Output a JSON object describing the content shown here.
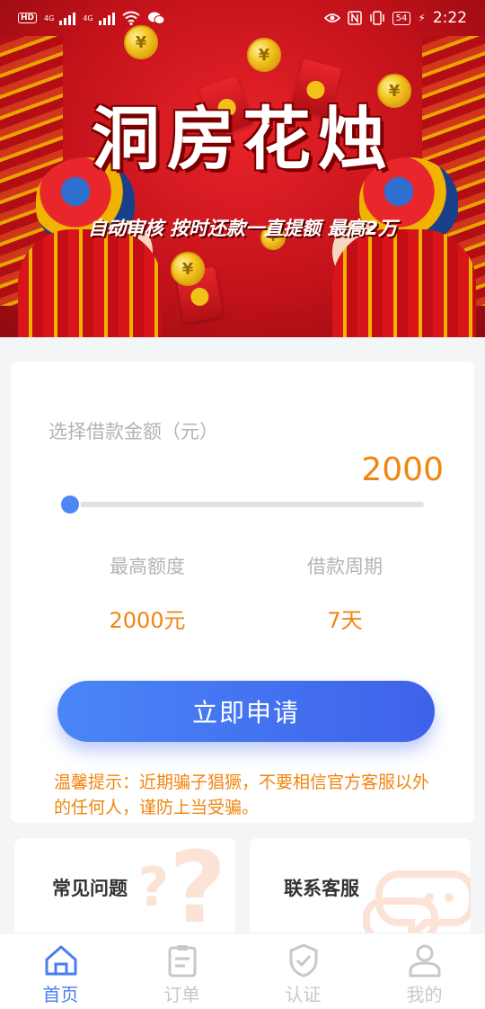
{
  "status_bar": {
    "left_badges": [
      "HD",
      "4G",
      "4G"
    ],
    "battery": "54",
    "time": "2:22"
  },
  "banner": {
    "title": "洞房花烛",
    "subtitle": "自动审核  按时还款一直提额  最高2万",
    "coin_symbol": "¥",
    "colors": {
      "background": "#d41a22",
      "gold": "#f2c21b"
    }
  },
  "loan": {
    "amount_label": "选择借款金额（元）",
    "amount_value": "2000",
    "slider_fraction": 0.0,
    "max_limit_label": "最高额度",
    "max_limit_value": "2000元",
    "period_label": "借款周期",
    "period_value": "7天",
    "apply_button": "立即申请",
    "notice": "温馨提示：近期骗子猖獗，不要相信官方客服以外的任何人，谨防上当受骗。",
    "colors": {
      "accent": "#f08510",
      "button": "#4a7ef0"
    }
  },
  "tiles": [
    {
      "label": "常见问题",
      "icon": "question-mark-icon"
    },
    {
      "label": "联系客服",
      "icon": "chat-bubble-icon"
    }
  ],
  "bottom_nav": [
    {
      "label": "首页",
      "icon": "home-icon",
      "active": true
    },
    {
      "label": "订单",
      "icon": "clipboard-icon",
      "active": false
    },
    {
      "label": "认证",
      "icon": "shield-check-icon",
      "active": false
    },
    {
      "label": "我的",
      "icon": "user-icon",
      "active": false
    }
  ]
}
